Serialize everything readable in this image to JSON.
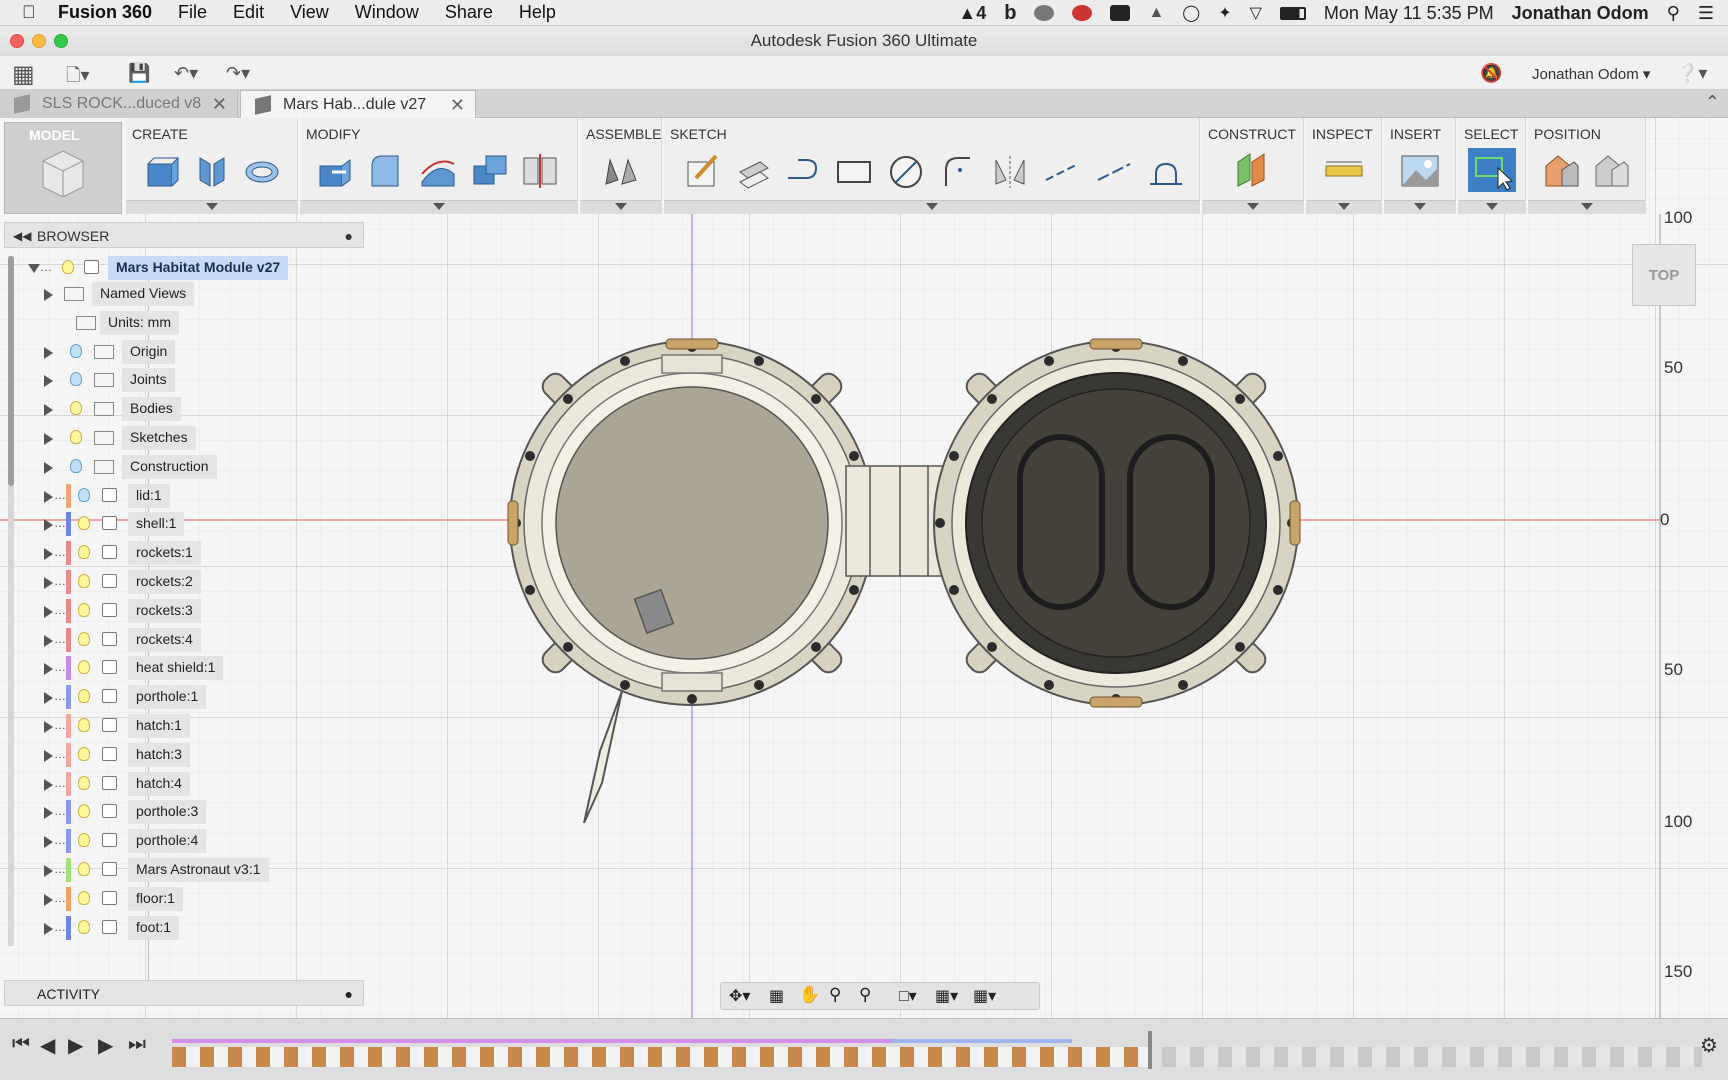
{
  "menubar": {
    "app_name": "Fusion 360",
    "items": [
      "File",
      "Edit",
      "View",
      "Window",
      "Share",
      "Help"
    ],
    "status_badge": "4",
    "clock": "Mon May 11  5:35 PM",
    "user": "Jonathan Odom"
  },
  "window": {
    "title": "Autodesk Fusion 360 Ultimate"
  },
  "quick_access": {
    "user_menu": "Jonathan Odom ▾"
  },
  "tabs": [
    {
      "label": "SLS ROCK...duced v8",
      "active": false
    },
    {
      "label": "Mars Hab...dule v27",
      "active": true
    }
  ],
  "toolbar": {
    "workspace": "MODEL",
    "groups": [
      "CREATE",
      "MODIFY",
      "ASSEMBLE",
      "SKETCH",
      "CONSTRUCT",
      "INSPECT",
      "INSERT",
      "SELECT",
      "POSITION"
    ]
  },
  "browser": {
    "title": "BROWSER",
    "root": "Mars Habitat Module v27",
    "items": [
      {
        "label": "Named Views",
        "kind": "folder",
        "bulb": "none",
        "color": ""
      },
      {
        "label": "Units: mm",
        "kind": "doc",
        "bulb": "none",
        "color": ""
      },
      {
        "label": "Origin",
        "kind": "folder",
        "bulb": "blue",
        "color": ""
      },
      {
        "label": "Joints",
        "kind": "folder",
        "bulb": "blue",
        "color": ""
      },
      {
        "label": "Bodies",
        "kind": "folder",
        "bulb": "yellow",
        "color": ""
      },
      {
        "label": "Sketches",
        "kind": "folder",
        "bulb": "yellow",
        "color": ""
      },
      {
        "label": "Construction",
        "kind": "folder",
        "bulb": "blue",
        "color": ""
      },
      {
        "label": "lid:1",
        "kind": "component",
        "bulb": "blue",
        "color": "#f2a678"
      },
      {
        "label": "shell:1",
        "kind": "component",
        "bulb": "yellow",
        "color": "#6f86e0"
      },
      {
        "label": "rockets:1",
        "kind": "component",
        "bulb": "yellow",
        "color": "#e88a8a"
      },
      {
        "label": "rockets:2",
        "kind": "component",
        "bulb": "yellow",
        "color": "#e88a8a"
      },
      {
        "label": "rockets:3",
        "kind": "component",
        "bulb": "yellow",
        "color": "#e88a8a"
      },
      {
        "label": "rockets:4",
        "kind": "component",
        "bulb": "yellow",
        "color": "#e88a8a"
      },
      {
        "label": "heat shield:1",
        "kind": "component",
        "bulb": "yellow",
        "color": "#c58ce0"
      },
      {
        "label": "porthole:1",
        "kind": "component",
        "bulb": "yellow",
        "color": "#8c98e8"
      },
      {
        "label": "hatch:1",
        "kind": "component",
        "bulb": "yellow",
        "color": "#f0a8a0"
      },
      {
        "label": "hatch:3",
        "kind": "component",
        "bulb": "yellow",
        "color": "#f0a8a0"
      },
      {
        "label": "hatch:4",
        "kind": "component",
        "bulb": "yellow",
        "color": "#f0a8a0"
      },
      {
        "label": "porthole:3",
        "kind": "component",
        "bulb": "yellow",
        "color": "#8c98e8"
      },
      {
        "label": "porthole:4",
        "kind": "component",
        "bulb": "yellow",
        "color": "#8c98e8"
      },
      {
        "label": "Mars Astronaut v3:1",
        "kind": "component",
        "bulb": "yellow",
        "color": "#a8e078"
      },
      {
        "label": "floor:1",
        "kind": "component",
        "bulb": "yellow",
        "color": "#f0a060"
      },
      {
        "label": "foot:1",
        "kind": "component",
        "bulb": "yellow",
        "color": "#6f86e0"
      }
    ]
  },
  "activity": {
    "title": "ACTIVITY"
  },
  "viewcube": {
    "face": "TOP"
  },
  "ruler": [
    "100",
    "50",
    "0",
    "50",
    "100",
    "150"
  ]
}
